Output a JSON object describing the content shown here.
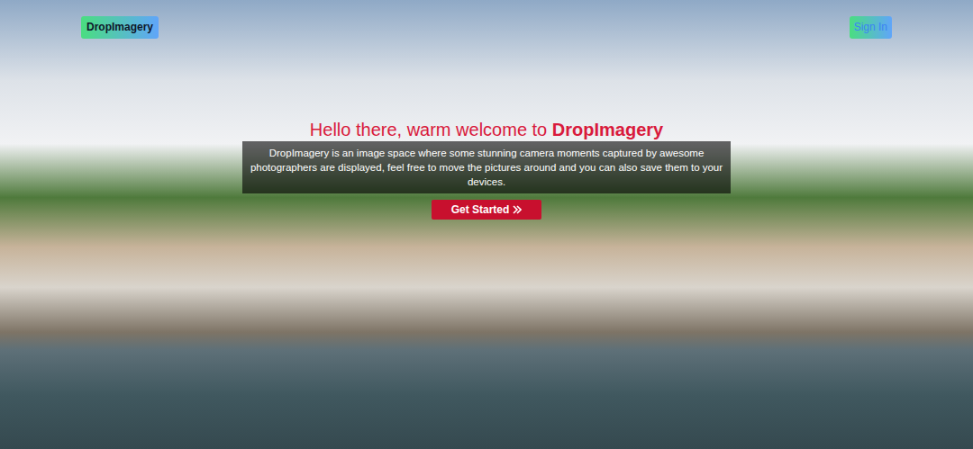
{
  "header": {
    "logo": "DropImagery",
    "sign_in": "Sign In"
  },
  "hero": {
    "heading_prefix": "Hello there, warm welcome to ",
    "heading_brand": "DropImagery",
    "description": "DropImagery is an image space where some stunning camera moments captured by awesome photographers are displayed, feel free to move the pictures around and you can also save them to your devices.",
    "cta": "Get Started"
  }
}
